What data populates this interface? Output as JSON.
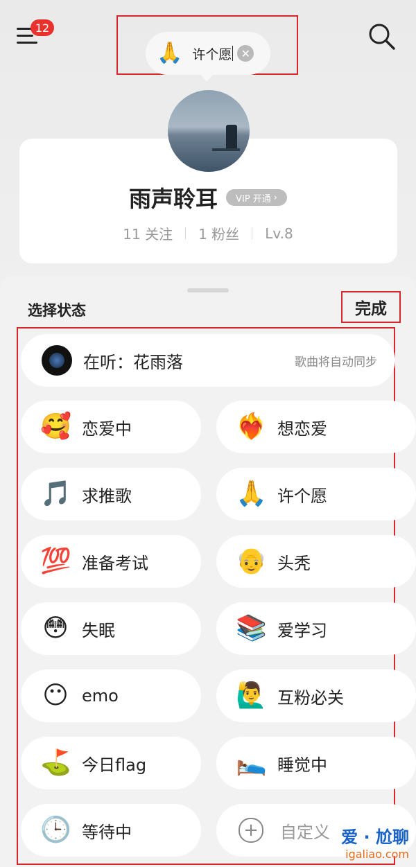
{
  "header": {
    "badge_count": "12",
    "wish": {
      "emoji": "🙏",
      "text": "许个愿"
    }
  },
  "profile": {
    "username": "雨声聆耳",
    "vip_badge": "VIP 开通",
    "following": "11 关注",
    "followers": "1 粉丝",
    "level": "Lv.8"
  },
  "sheet": {
    "title": "选择状态",
    "done_label": "完成",
    "now_playing": {
      "label": "在听：花雨落",
      "hint": "歌曲将自动同步"
    },
    "statuses": [
      {
        "emoji": "🥰",
        "label": "恋爱中"
      },
      {
        "emoji": "❤️‍🔥",
        "label": "想恋爱"
      },
      {
        "emoji": "🎵",
        "label": "求推歌"
      },
      {
        "emoji": "🙏",
        "label": "许个愿"
      },
      {
        "emoji": "💯",
        "label": "准备考试"
      },
      {
        "emoji": "👴",
        "label": "头秃"
      },
      {
        "emoji": "😳",
        "label": "失眠"
      },
      {
        "emoji": "📚",
        "label": "爱学习"
      },
      {
        "emoji": "😶",
        "label": "emo"
      },
      {
        "emoji": "🙋‍♂️",
        "label": "互粉必关"
      },
      {
        "emoji": "⛳",
        "label": "今日flag"
      },
      {
        "emoji": "🛌",
        "label": "睡觉中"
      },
      {
        "emoji": "🕒",
        "label": "等待中"
      },
      {
        "emoji": "+",
        "label": "自定义"
      }
    ]
  },
  "watermark": {
    "line1": "爱 · 尬聊",
    "line2": "igaliao.com"
  },
  "colors": {
    "accent": "#e8322e",
    "highlight": "#d9262a"
  },
  "icons": [
    "menu-icon",
    "search-icon",
    "clear-icon",
    "vinyl-icon",
    "plus-icon"
  ]
}
